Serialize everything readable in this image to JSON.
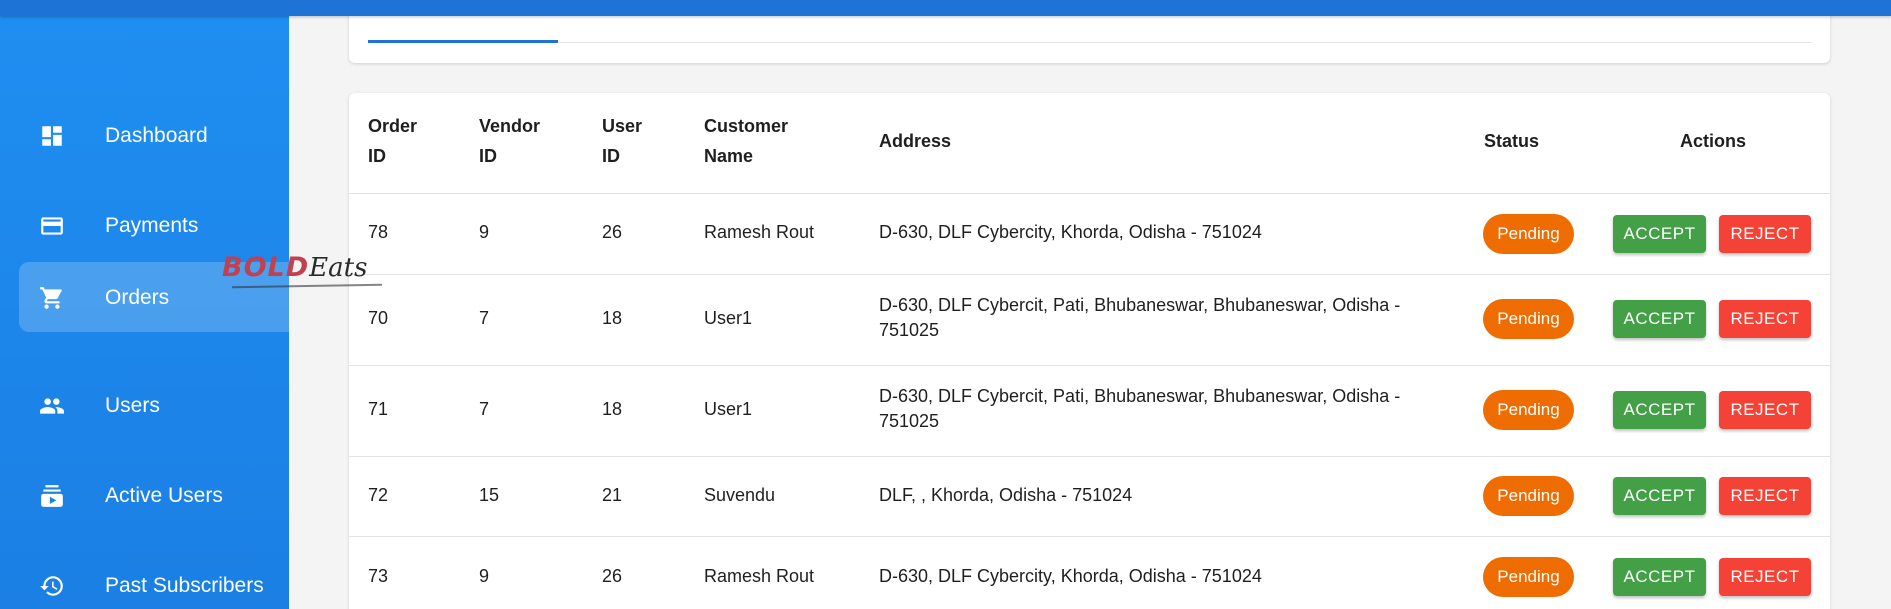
{
  "sidebar": {
    "items": [
      {
        "label": "Dashboard",
        "icon": "dashboard-icon"
      },
      {
        "label": "Payments",
        "icon": "credit-card-icon"
      },
      {
        "label": "Orders",
        "icon": "shopping-cart-icon"
      },
      {
        "label": "Users",
        "icon": "people-icon"
      },
      {
        "label": "Active Users",
        "icon": "subscriptions-icon"
      },
      {
        "label": "Past Subscribers",
        "icon": "history-icon"
      }
    ]
  },
  "logo": {
    "part1": "BOLD",
    "part2": "Eats"
  },
  "table": {
    "headers": {
      "order_id_1": "Order",
      "order_id_2": "ID",
      "vendor_id_1": "Vendor",
      "vendor_id_2": "ID",
      "user_id_1": "User",
      "user_id_2": "ID",
      "customer_name_1": "Customer",
      "customer_name_2": "Name",
      "address": "Address",
      "status": "Status",
      "actions": "Actions"
    },
    "accept_label": "ACCEPT",
    "reject_label": "REJECT",
    "rows": [
      {
        "order_id": "78",
        "vendor_id": "9",
        "user_id": "26",
        "customer": "Ramesh Rout",
        "address": "D-630, DLF Cybercity, Khorda, Odisha - 751024",
        "status": "Pending"
      },
      {
        "order_id": "70",
        "vendor_id": "7",
        "user_id": "18",
        "customer": "User1",
        "address": "D-630, DLF Cybercit, Pati, Bhubaneswar, Bhubaneswar, Odisha - 751025",
        "status": "Pending"
      },
      {
        "order_id": "71",
        "vendor_id": "7",
        "user_id": "18",
        "customer": "User1",
        "address": "D-630, DLF Cybercit, Pati, Bhubaneswar, Bhubaneswar, Odisha - 751025",
        "status": "Pending"
      },
      {
        "order_id": "72",
        "vendor_id": "15",
        "user_id": "21",
        "customer": "Suvendu",
        "address": "DLF, , Khorda, Odisha - 751024",
        "status": "Pending"
      },
      {
        "order_id": "73",
        "vendor_id": "9",
        "user_id": "26",
        "customer": "Ramesh Rout",
        "address": "D-630, DLF Cybercity, Khorda, Odisha - 751024",
        "status": "Pending"
      }
    ]
  },
  "colors": {
    "sidebar": "#1f8ef1",
    "topbar": "#1d74d6",
    "pending": "#ef6c00",
    "accept": "#43a047",
    "reject": "#f44336"
  }
}
